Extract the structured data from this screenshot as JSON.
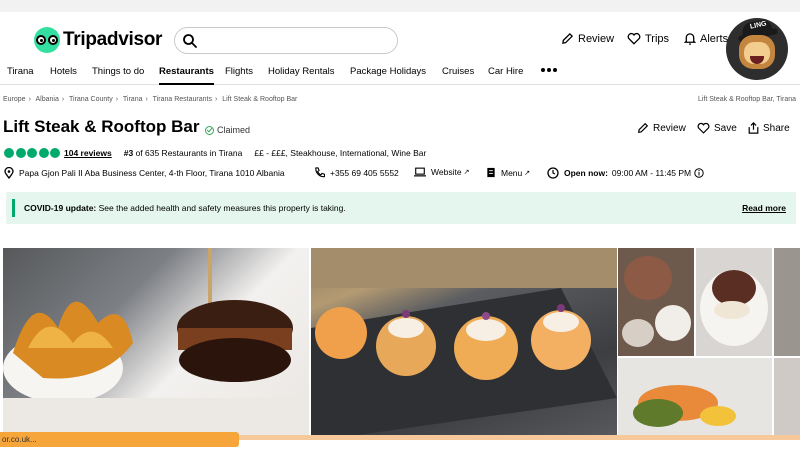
{
  "header": {
    "logo_text": "Tripadvisor",
    "search_placeholder": "",
    "actions": [
      {
        "label": "Review",
        "icon": "pencil-icon"
      },
      {
        "label": "Trips",
        "icon": "heart-icon"
      },
      {
        "label": "Alerts",
        "icon": "bell-icon"
      }
    ],
    "mascot_badge": "LING"
  },
  "nav": {
    "items": [
      "Tirana",
      "Hotels",
      "Things to do",
      "Restaurants",
      "Flights",
      "Holiday Rentals",
      "Package Holidays",
      "Cruises",
      "Car Hire"
    ],
    "active": "Restaurants"
  },
  "breadcrumb": {
    "items": [
      "Europe",
      "Albania",
      "Tirana County",
      "Tirana",
      "Tirana Restaurants",
      "Lift Steak & Rooftop Bar"
    ],
    "right": "Lift Steak & Rooftop Bar, Tirana"
  },
  "listing": {
    "title": "Lift Steak & Rooftop Bar",
    "claimed": "Claimed",
    "actions": [
      {
        "label": "Review",
        "icon": "pencil-icon"
      },
      {
        "label": "Save",
        "icon": "heart-icon"
      },
      {
        "label": "Share",
        "icon": "share-icon"
      }
    ],
    "rating_bubbles": 5,
    "reviews": "104 reviews",
    "rank_num": "#3",
    "rank_text": " of 635 Restaurants in Tirana",
    "cuisine": "££ - £££, Steakhouse, International, Wine Bar",
    "address": "Papa Gjon Pali II Aba Business Center, 4-th Floor, Tirana 1010 Albania",
    "phone": "+355 69 405 5552",
    "website": "Website",
    "menu": "Menu",
    "open_label": "Open now:",
    "hours": "09:00 AM - 11:45 PM"
  },
  "covid": {
    "title": "COVID-19 update:",
    "text": " See the added health and safety measures this property is taking.",
    "link": "Read more"
  },
  "status_bar": "or.co.uk...",
  "colors": {
    "brand_green": "#34e0a1",
    "bubble_green": "#00aa6c",
    "covid_bg": "#e4f6ee",
    "status_orange": "#f6a53a"
  }
}
